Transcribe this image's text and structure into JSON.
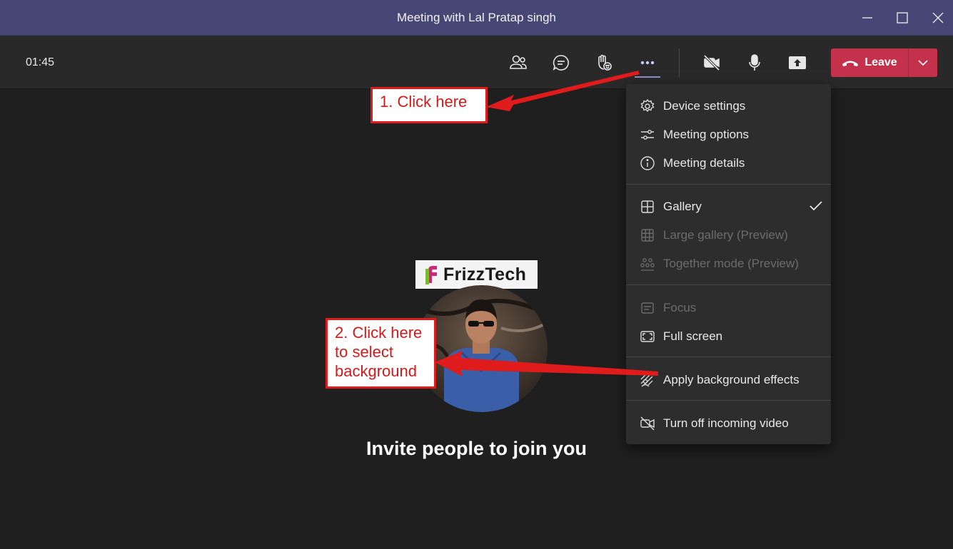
{
  "window": {
    "title": "Meeting with Lal Pratap singh",
    "controls": [
      "minimize-icon",
      "maximize-icon",
      "close-icon"
    ]
  },
  "toolbar": {
    "timer": "01:45",
    "buttons": [
      "people-icon",
      "chat-icon",
      "raise-hand-icon",
      "more-options-icon",
      "camera-off-icon",
      "microphone-icon",
      "share-screen-icon"
    ],
    "leave_label": "Leave",
    "leave_color": "#c4314b"
  },
  "menu": {
    "items": [
      {
        "label": "Device settings",
        "icon": "gear-icon",
        "enabled": true
      },
      {
        "label": "Meeting options",
        "icon": "sliders-icon",
        "enabled": true
      },
      {
        "label": "Meeting details",
        "icon": "info-icon",
        "enabled": true
      },
      {
        "label": "Gallery",
        "icon": "gallery-icon",
        "enabled": true,
        "checked": true
      },
      {
        "label": "Large gallery (Preview)",
        "icon": "large-gallery-icon",
        "enabled": false
      },
      {
        "label": "Together mode (Preview)",
        "icon": "together-mode-icon",
        "enabled": false
      },
      {
        "label": "Focus",
        "icon": "focus-icon",
        "enabled": false
      },
      {
        "label": "Full screen",
        "icon": "fullscreen-icon",
        "enabled": true
      },
      {
        "label": "Apply background effects",
        "icon": "background-effects-icon",
        "enabled": true
      },
      {
        "label": "Turn off incoming video",
        "icon": "video-off-icon",
        "enabled": true
      }
    ]
  },
  "stage": {
    "brand_text": "FrizzTech",
    "invite_text": "Invite people to join you"
  },
  "annotations": {
    "callout1": "1. Click here",
    "callout2_line1": "2. Click here",
    "callout2_line2": "to select",
    "callout2_line3": "background",
    "color": "#e01b1b"
  }
}
